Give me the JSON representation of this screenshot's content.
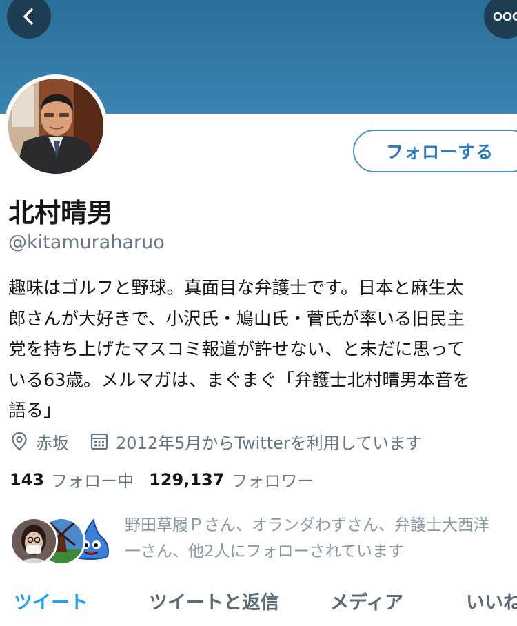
{
  "header": {
    "back_icon": "chevron-left-icon",
    "more_icon": "more-horizontal-icon"
  },
  "profile": {
    "display_name": "北村晴男",
    "handle": "@kitamuraharuo",
    "follow_label": "フォローする",
    "bio_lines": [
      "趣味はゴルフと野球。真面目な弁護士です。日本と麻生太",
      "郎さんが大好きで、小沢氏・鳩山氏・菅氏が率いる旧民主",
      "党を持ち上げたマスコミ報道が許せない、と未だに思って",
      "いる63歳。メルマガは、まぐまぐ「弁護士北村晴男本音を",
      "語る」"
    ],
    "location": "赤坂",
    "joined": "2012年5月からTwitterを利用しています"
  },
  "stats": {
    "following_count": "143",
    "following_label": "フォロー中",
    "followers_count": "129,137",
    "followers_label": "フォロワー"
  },
  "followed_by": {
    "line1": "野田草履Ｐさん、オランダわずさん、弁護士大西洋",
    "line2": "一さん、他2人にフォローされています"
  },
  "tabs": [
    {
      "label": "ツイート",
      "active": true
    },
    {
      "label": "ツイートと返信",
      "active": false
    },
    {
      "label": "メディア",
      "active": false
    },
    {
      "label": "いいね",
      "active": false
    }
  ],
  "colors": {
    "banner": "#3a84b2",
    "accent": "#1da1f2",
    "follow_border": "#4a90c8",
    "secondary_text": "#657786"
  }
}
